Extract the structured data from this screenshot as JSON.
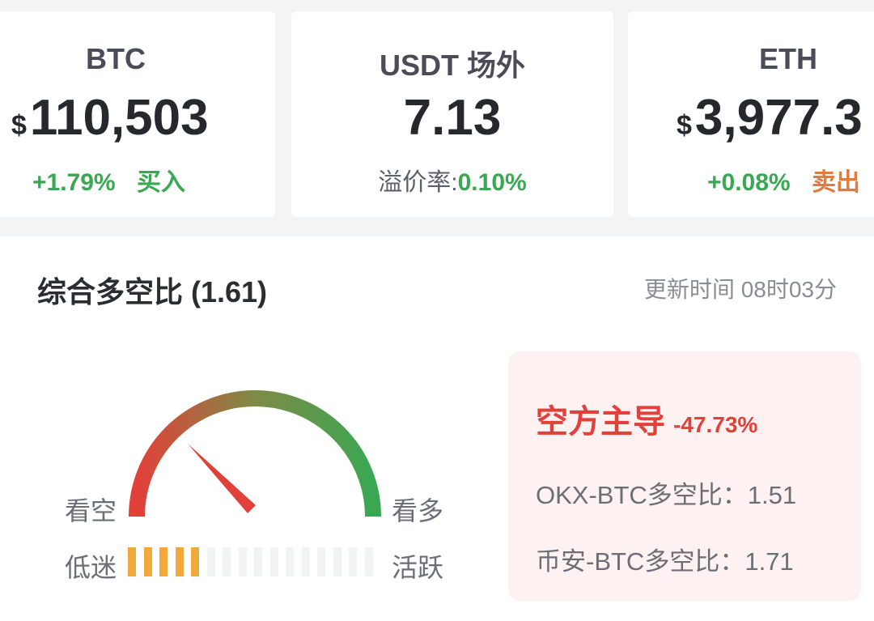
{
  "tickers": [
    {
      "symbol": "BTC",
      "currency": "$",
      "price": "110,503",
      "change": "+1.79%",
      "action": "买入"
    },
    {
      "symbol": "USDT 场外",
      "price": "7.13",
      "premium_label": "溢价率:",
      "premium_value": "0.10%"
    },
    {
      "symbol": "ETH",
      "currency": "$",
      "price": "3,977.3",
      "change": "+0.08%",
      "action": "卖出"
    }
  ],
  "panel": {
    "title": "综合多空比 (1.61)",
    "update_time": "更新时间 08时03分"
  },
  "gauge": {
    "bear_label": "看空",
    "bull_label": "看多",
    "low_label": "低迷",
    "high_label": "活跃",
    "active_bars": 5,
    "total_bars": 16,
    "colors": {
      "bear": "#e2403a",
      "bull": "#3aa853",
      "bar_on": "#f2a93b"
    }
  },
  "summary": {
    "dominance": "空方主导",
    "dominance_pct": "-47.73%",
    "okx_ratio": "OKX-BTC多空比：1.51",
    "binance_ratio": "币安-BTC多空比：1.71"
  }
}
